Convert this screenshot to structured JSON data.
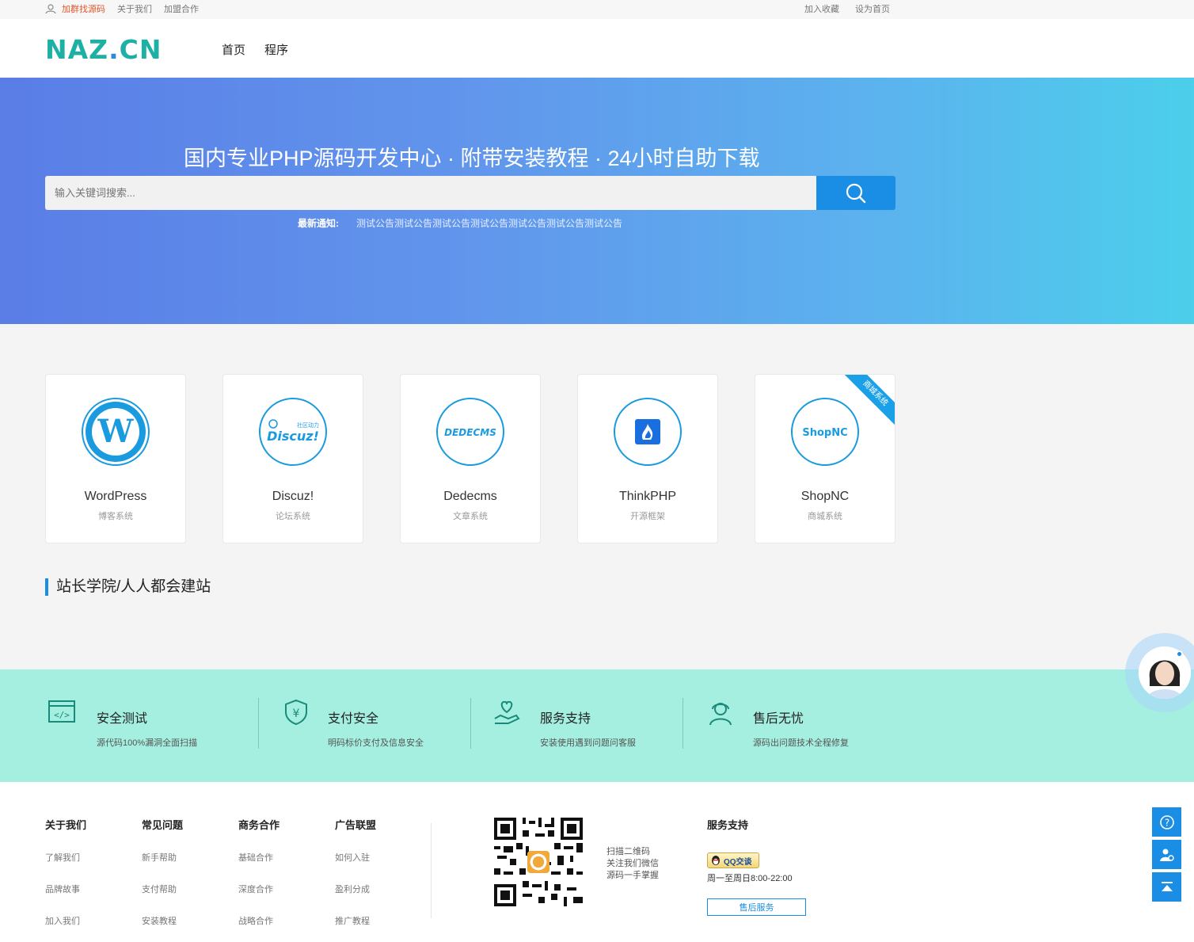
{
  "topbar": {
    "left_links": [
      "加群找源码",
      "关于我们",
      "加盟合作"
    ],
    "right_links": [
      "加入收藏",
      "设为首页"
    ]
  },
  "header": {
    "logo_text": "NAZ",
    "logo_dot": ".",
    "logo_text2": "CN",
    "nav": [
      "首页",
      "程序"
    ]
  },
  "hero": {
    "title": "国内专业PHP源码开发中心 · 附带安装教程 · 24小时自助下载",
    "search_placeholder": "输入关键词搜索...",
    "notice_label": "最新通知:",
    "notice_text": "测试公告测试公告测试公告测试公告测试公告测试公告测试公告"
  },
  "cards": [
    {
      "name": "WordPress",
      "sub": "博客系统",
      "logo": "wordpress-logo"
    },
    {
      "name": "Discuz!",
      "sub": "论坛系统",
      "logo": "discuz-logo",
      "logo_text": "Discuz!",
      "logo_small": "社区动力"
    },
    {
      "name": "Dedecms",
      "sub": "文章系统",
      "logo": "dedecms-logo",
      "logo_text": "DEDECMS"
    },
    {
      "name": "ThinkPHP",
      "sub": "开源框架",
      "logo": "thinkphp-logo"
    },
    {
      "name": "ShopNC",
      "sub": "商城系统",
      "logo": "shopnc-logo",
      "logo_text": "ShopNC",
      "ribbon": "商城系统"
    }
  ],
  "section_title": "站长学院/人人都会建站",
  "features": [
    {
      "title": "安全测试",
      "desc": "源代码100%漏洞全面扫描",
      "icon": "code-window-icon"
    },
    {
      "title": "支付安全",
      "desc": "明码标价支付及信息安全",
      "icon": "shield-yen-icon"
    },
    {
      "title": "服务支持",
      "desc": "安装使用遇到问题问客服",
      "icon": "heart-hand-icon"
    },
    {
      "title": "售后无忧",
      "desc": "源码出问题技术全程修复",
      "icon": "headset-agent-icon"
    }
  ],
  "footer": {
    "columns": [
      {
        "title": "关于我们",
        "links": [
          "了解我们",
          "品牌故事",
          "加入我们"
        ]
      },
      {
        "title": "常见问题",
        "links": [
          "新手帮助",
          "支付帮助",
          "安装教程"
        ]
      },
      {
        "title": "商务合作",
        "links": [
          "基础合作",
          "深度合作",
          "战略合作"
        ]
      },
      {
        "title": "广告联盟",
        "links": [
          "如何入驻",
          "盈利分成",
          "推广教程"
        ]
      }
    ],
    "qr_lines": [
      "扫描二维码",
      "关注我们微信",
      "源码一手掌握"
    ],
    "support_title": "服务支持",
    "qq_label": "QQ交谈",
    "hours": "周一至周日8:00-22:00",
    "after_sales": "售后服务"
  },
  "colors": {
    "primary": "#1a8de4",
    "logo_teal": "#1fb0a5",
    "feature_bg": "#a4efdf",
    "topbar_highlight": "#e4572e"
  }
}
